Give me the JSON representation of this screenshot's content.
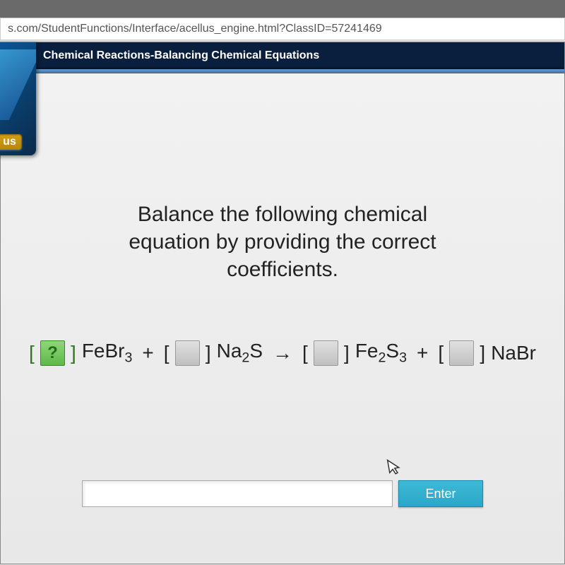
{
  "address_bar": {
    "url": "s.com/StudentFunctions/Interface/acellus_engine.html?ClassID=57241469"
  },
  "header": {
    "title": "Chemical Reactions-Balancing Chemical Equations"
  },
  "logo": {
    "tag": "us"
  },
  "prompt": {
    "line1": "Balance the following chemical",
    "line2": "equation by providing the correct",
    "line3": "coefficients."
  },
  "equation": {
    "coef1": "?",
    "term1_a": "FeBr",
    "term1_sub": "3",
    "plus1": "+",
    "coef2": "",
    "term2_a": "Na",
    "term2_sub1": "2",
    "term2_b": "S",
    "arrow": "→",
    "coef3": "",
    "term3_a": "Fe",
    "term3_sub1": "2",
    "term3_b": "S",
    "term3_sub2": "3",
    "plus2": "+",
    "coef4": "",
    "term4": "NaBr"
  },
  "answer": {
    "value": "",
    "placeholder": "",
    "button": "Enter"
  }
}
